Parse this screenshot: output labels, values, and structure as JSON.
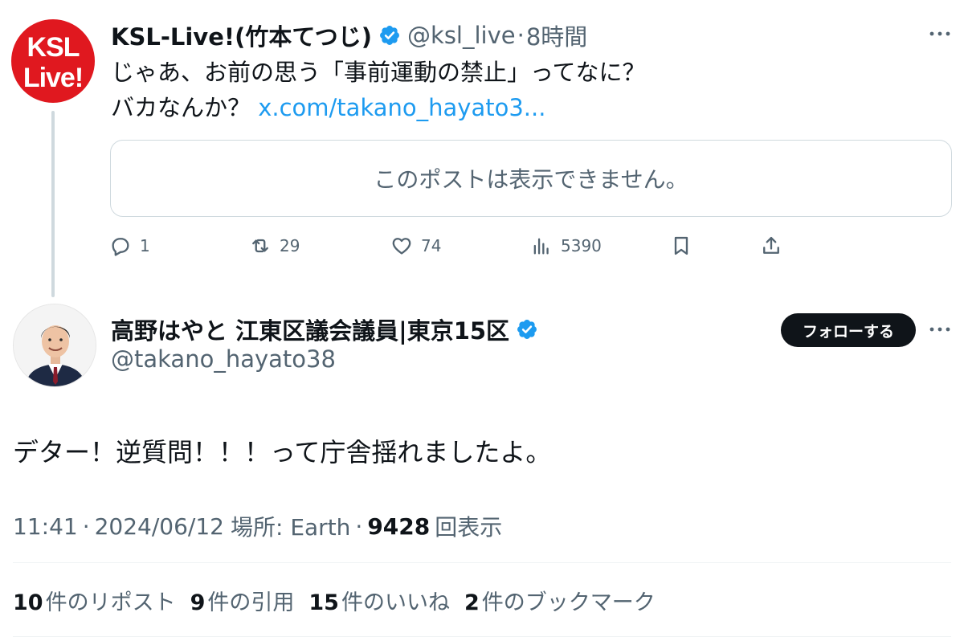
{
  "parent_post": {
    "display_name": "KSL-Live!(竹本てつじ)",
    "handle": "@ksl_live",
    "separator": "·",
    "time": "8時間",
    "avatar_text_line1": "KSL",
    "avatar_text_line2": "Live!",
    "text_line1": "じゃあ、お前の思う「事前運動の禁止」ってなに？",
    "text_line2": "バカなんか？ ",
    "link_text": "x.com/takano_hayato3...",
    "quote_unavailable": "このポストは表示できません。",
    "actions": {
      "replies": "1",
      "reposts": "29",
      "likes": "74",
      "views": "5390"
    }
  },
  "main_post": {
    "display_name": "高野はやと 江東区議会議員|東京15区",
    "handle": "@takano_hayato38",
    "follow_label": "フォローする",
    "text": "デター！逆質問！！！って庁舎揺れましたよ。",
    "time": "11:41",
    "date": "2024/06/12",
    "location": "場所: Earth",
    "separator": "·",
    "views_count": "9428",
    "views_label": "回表示",
    "stats": {
      "reposts_count": "10",
      "reposts_label": "件のリポスト",
      "quotes_count": "9",
      "quotes_label": "件の引用",
      "likes_count": "15",
      "likes_label": "件のいいね",
      "bookmarks_count": "2",
      "bookmarks_label": "件のブックマーク"
    }
  },
  "colors": {
    "text_primary": "#0f1419",
    "text_secondary": "#536471",
    "link": "#1d9bf0",
    "verified": "#1d9bf0",
    "ksl_avatar_bg": "#e0181f",
    "border": "#cfd9de"
  },
  "icons": {
    "verified": "verified-badge-icon",
    "more": "more-horizontal-icon",
    "reply": "reply-icon",
    "repost": "repost-icon",
    "like": "heart-icon",
    "views": "views-chart-icon",
    "bookmark": "bookmark-icon",
    "share": "share-icon"
  }
}
